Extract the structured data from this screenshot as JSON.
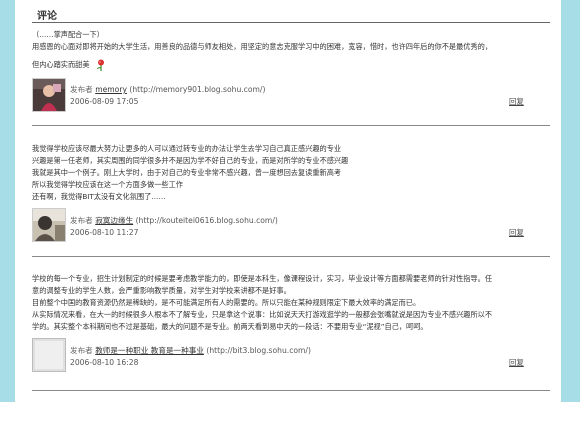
{
  "section_title": "评论",
  "comments": [
    {
      "lines": [
        "（……掌声配合一下）",
        "用感恩的心面对即将开始的大学生活，用善良的品德与师友相处，用坚定的意志克服学习中的困难，宽容，惜时，也许四年后的你不是最优秀的，",
        "但内心踏实而甜美"
      ],
      "publisher_label": "发布者",
      "author": "memory",
      "url": "(http://memory901.blog.sohu.com/)",
      "date": "2006-08-09 17:05",
      "reply": "回复",
      "icon": "rose-icon"
    },
    {
      "lines": [
        "我觉得学校应该尽最大努力让更多的人可以通过转专业的办法让学生去学习自己真正感兴趣的专业",
        "兴趣是第一任老师，其实周围的同学很多并不是因为学不好自己的专业，而是对所学的专业不感兴趣",
        "我就是其中一个例子。刚上大学时，由于对自己的专业非常不感兴趣，曾一度想回去复读重新高考",
        "所以我觉得学校应该在这一个方面多做一些工作",
        "还有啊，我觉得BIT太没有文化氛围了……"
      ],
      "publisher_label": "发布者",
      "author": "寂寞边缘生",
      "url": "(http://kouteitei0616.blog.sohu.com/)",
      "date": "2006-08-10 11:27",
      "reply": "回复"
    },
    {
      "lines": [
        "学校的每一个专业，招生计划制定的时候是要考虑教学能力的，即使是本科生，像课程设计，实习，毕业设计等方面都需要老师的针对性指导。任",
        "意的调整专业的学生人数，会严重影响教学质量，对学生对学校来讲都不是好事。",
        "目前整个中国的教育资源仍然是稀缺的，是不可能满足所有人的需要的。所以只能在某种规则限定下最大效率的满足而已。",
        "从实际情况来看，在大一的时候很多人根本不了解专业，只是拿这个说事：比如说天天打游戏逛学的一般都会张嘴就说是因为专业不感兴趣所以不",
        "学的。其实整个本科期间也不过是基础，最大的问题不是专业。前两天看到易中天的一段话：不要用专业“泥视”自己，呵呵。"
      ],
      "publisher_label": "发布者",
      "author": "教师是一种职业 教育是一种事业",
      "url": "(http://bit3.blog.sohu.com/)",
      "date": "2006-08-10 16:28",
      "reply": "回复"
    }
  ]
}
